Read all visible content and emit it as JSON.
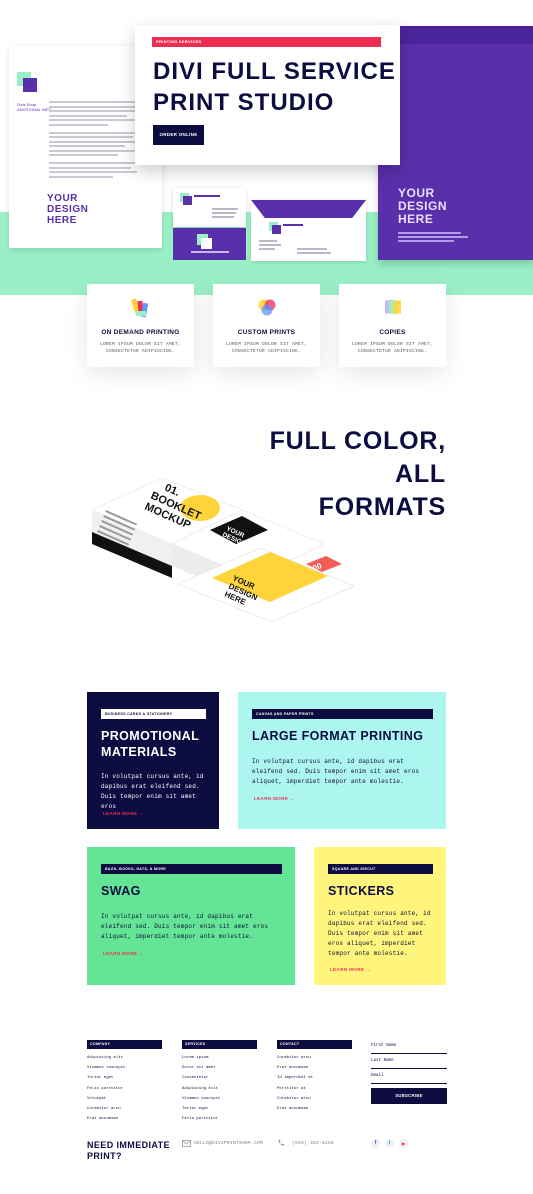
{
  "hero": {
    "tag": "PRINTING SERVICES",
    "title_line1": "DIVI FULL SERVICE",
    "title_line2": "PRINT STUDIO",
    "button_label": "ORDER ONLINE",
    "mock_text": "YOUR DESIGN HERE",
    "colors": {
      "accent": "#ee2d53",
      "navy": "#0d0c40",
      "purple": "#5a2fab",
      "mint": "#9af0c6"
    }
  },
  "services": [
    {
      "title": "ON DEMAND PRINTING",
      "desc": "LOREM IPSUM DOLOR SIT AMET, CONSECTETUR ADIPISCING.",
      "icon": "printer-swatch-icon"
    },
    {
      "title": "CUSTOM PRINTS",
      "desc": "LOREM IPSUM DOLOR SIT AMET, CONSECTETUR ADIPISCING.",
      "icon": "color-drop-icon"
    },
    {
      "title": "COPIES",
      "desc": "LOREM IPSUM DOLOR SIT AMET, CONSECTETUR ADIPISCING.",
      "icon": "copies-icon"
    }
  ],
  "fullcolor": {
    "title_line1": "FULL COLOR, ALL",
    "title_line2": "FORMATS",
    "mockup_label_1": "01. BOOKLET MOCKUP",
    "mockup_label_2": "YOUR DESIGN HERE",
    "mockup_number": "00"
  },
  "categories": {
    "promo": {
      "tag": "BUSINESS CARDS & STATIONERY",
      "title_line1": "PROMOTIONAL",
      "title_line2": "MATERIALS",
      "desc": "In volutpat cursus ante, id dapibus erat eleifend sed. Duis tempor enim sit amet eros",
      "link": "LEARN MORE →",
      "color": "#0d0c40"
    },
    "large": {
      "tag": "CANVAS AND PAPER PRINTS",
      "title": "LARGE FORMAT PRINTING",
      "desc": "In volutpat cursus ante, id dapibus erat eleifend sed. Duis tempor enim sit amet eros aliquet, imperdiet tempor ante molestie.",
      "link": "LEARN MORE →",
      "color": "#adf6f0"
    },
    "swag": {
      "tag": "BAGS, BOOKS, HATS, & MORE",
      "title": "SWAG",
      "desc": "In volutpat cursus ante, id dapibus erat eleifend sed. Duis tempor enim sit amet eros aliquet, imperdiet tempor ante molestie.",
      "link": "LEARN MORE →",
      "color": "#64e595"
    },
    "stickers": {
      "tag": "SQUARE AND DIECUT",
      "title": "STICKERS",
      "desc": "In volutpat cursus ante, id dapibus erat eleifend sed. Duis tempor enim sit amet eros aliquet, imperdiet tempor ante molestie.",
      "link": "LEARN MORE →",
      "color": "#fff47c"
    }
  },
  "footer": {
    "company": {
      "heading": "COMPANY",
      "items": [
        "Adipiscing elit",
        "Vivamus suscipit",
        "Tortor eget",
        "Felis porttitor",
        "Volutpat",
        "Curabitur arcu",
        "Erat accumsan"
      ]
    },
    "services": {
      "heading": "SERVICES",
      "items": [
        "Lorem ipsum",
        "Dolor sit amet",
        "Consectetur",
        "Adipiscing elit",
        "Vivamus suscipit",
        "Tortor eget",
        "Felis porttitor"
      ]
    },
    "contact": {
      "heading": "CONTACT",
      "items": [
        "Curabitur arcu",
        "Erat accumsan",
        "Id imperdiet et",
        "Porttitor at",
        "Curabitur arcu",
        "Erat accumsan"
      ]
    },
    "form": {
      "first_name": "First Name",
      "last_name": "Last Name",
      "email": "Email",
      "submit": "SUBSCRIBE"
    },
    "need_line1": "NEED IMMEDIATE",
    "need_line2": "PRINT?",
    "email": "HELLO@DIVIPRINTSHOP.COM",
    "phone": "(555) 352-6258",
    "social": [
      "f",
      "t",
      "▶"
    ]
  }
}
